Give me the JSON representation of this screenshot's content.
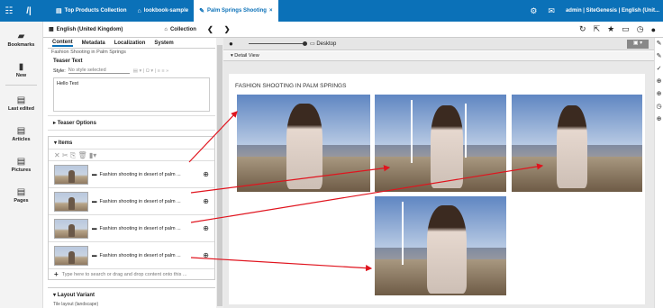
{
  "topbar": {
    "tabs": [
      {
        "icon": "product-collection-icon",
        "glyph": "▤",
        "label": "Top Products Collection"
      },
      {
        "icon": "site-icon",
        "glyph": "⌂",
        "label": "lookbook-sample"
      },
      {
        "icon": "pencil-icon",
        "glyph": "✎",
        "label": "Palm Springs Shooting"
      }
    ],
    "active_tab": 2,
    "close_glyph": "×",
    "user": "admin | SiteGenesis | English (Unit..."
  },
  "subbar": {
    "locale": "English (United Kingdom)",
    "collection": "Collection"
  },
  "leftnav": {
    "items": [
      {
        "label": "Bookmarks",
        "icon": "bookmark-icon"
      },
      {
        "label": "New",
        "icon": "new-document-icon"
      },
      {
        "label": "Last edited",
        "icon": "last-edited-icon"
      },
      {
        "label": "Articles",
        "icon": "articles-icon"
      },
      {
        "label": "Pictures",
        "icon": "pictures-icon"
      },
      {
        "label": "Pages",
        "icon": "pages-icon"
      }
    ]
  },
  "form": {
    "tabs": [
      "Content",
      "Metadata",
      "Localization",
      "System"
    ],
    "truncated_title": "Fashion Shooting in Palm Springs",
    "teaser_text_label": "Teaser Text",
    "style_label": "Style:",
    "style_value": "No style selected",
    "teaser_text_value": "Hello Test",
    "teaser_options_label": "Teaser Options",
    "items_label": "Items",
    "items": [
      {
        "title": "Fashion shooting in desert of palm ..."
      },
      {
        "title": "Fashion shooting in desert of palm ..."
      },
      {
        "title": "Fashion shooting in desert of palm ..."
      },
      {
        "title": "Fashion shooting in desert of palm ..."
      }
    ],
    "add_placeholder": "Type here to search or drag and drop content onto this ...",
    "layout_variant_label": "Layout Variant",
    "layout_variant_value": "Tile layout (landscape)"
  },
  "preview": {
    "device": "Desktop",
    "detail_view": "Detail View",
    "heading": "FASHION SHOOTING IN PALM SPRINGS"
  },
  "colors": {
    "accent": "#0b71b8",
    "arrow": "#e0141e"
  }
}
